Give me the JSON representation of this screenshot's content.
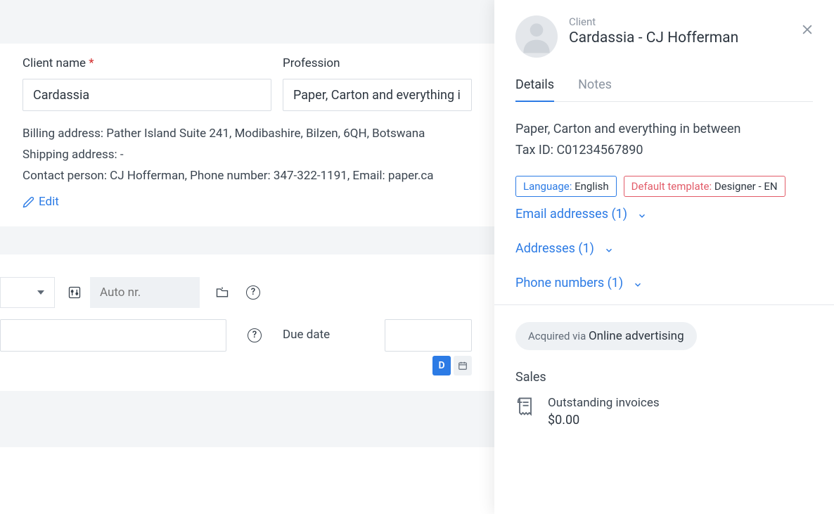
{
  "form": {
    "client_name_label": "Client name",
    "client_name_value": "Cardassia",
    "profession_label": "Profession",
    "profession_value": "Paper, Carton and everything in b",
    "billing_prefix": "Billing address: ",
    "billing_value": "Pather Island Suite 241, Modibashire, Bilzen, 6QH, Botswana",
    "shipping_prefix": "Shipping address: ",
    "shipping_value": "-",
    "contact_prefix": "Contact person: ",
    "contact_value": "CJ Hofferman,",
    "phone_prefix": "  Phone number: ",
    "phone_value": "347-322-1191,",
    "email_prefix": "  Email: ",
    "email_value": "paper.ca",
    "edit_label": "Edit"
  },
  "toolbar": {
    "auto_nr_placeholder": "Auto nr.",
    "due_date_label": "Due date",
    "toggle_d": "D"
  },
  "panel": {
    "client_label": "Client",
    "client_name": "Cardassia - CJ Hofferman",
    "tabs": {
      "details": "Details",
      "notes": "Notes"
    },
    "desc_line1": "Paper, Carton and everything in between",
    "tax_prefix": "Tax ID: ",
    "tax_value": "C01234567890",
    "language_key": "Language: ",
    "language_val": "English",
    "template_key": "Default template: ",
    "template_val": "Designer - EN",
    "expand_emails": "Email addresses (1)",
    "expand_addresses": "Addresses (1)",
    "expand_phones": "Phone numbers (1)",
    "acquired_key": "Acquired via ",
    "acquired_val": "Online advertising",
    "sales_heading": "Sales",
    "outstanding_label": "Outstanding invoices",
    "outstanding_value": "$0.00"
  }
}
